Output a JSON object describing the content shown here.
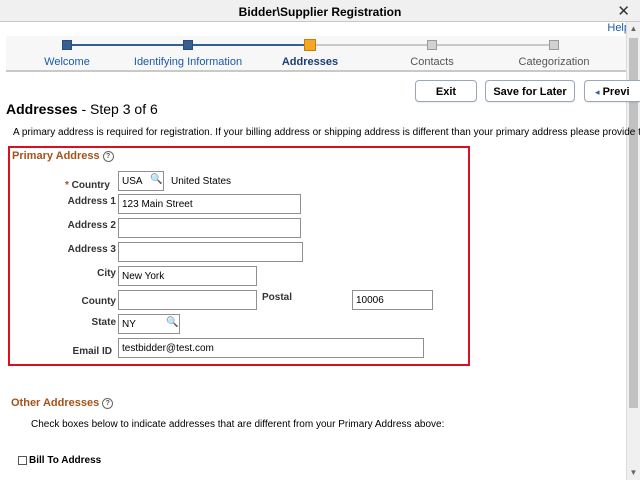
{
  "window": {
    "title": "Bidder\\Supplier Registration",
    "close_glyph": "✕"
  },
  "help_link": "Help",
  "steps": [
    {
      "label": "Welcome",
      "state": "complete"
    },
    {
      "label": "Identifying Information",
      "state": "complete"
    },
    {
      "label": "Addresses",
      "state": "current"
    },
    {
      "label": "Contacts",
      "state": "pending"
    },
    {
      "label": "Categorization",
      "state": "pending"
    }
  ],
  "toolbar": {
    "exit": "Exit",
    "save_for_later": "Save for Later",
    "previous": "Previ",
    "previous_glyph": "◂"
  },
  "page": {
    "title": "Addresses",
    "step_text": "- Step 3 of 6",
    "intro": "A primary address is required for registration.  If your billing address or shipping address is different than your primary address please provide them."
  },
  "primary_address": {
    "title": "Primary Address",
    "help_glyph": "?",
    "fields": {
      "country": {
        "required_mark": "*",
        "label": "Country",
        "value": "USA",
        "description": "United States"
      },
      "address1": {
        "label": "Address 1",
        "value": "123 Main Street"
      },
      "address2": {
        "label": "Address 2",
        "value": ""
      },
      "address3": {
        "label": "Address 3",
        "value": ""
      },
      "city": {
        "label": "City",
        "value": "New York"
      },
      "county": {
        "label": "County",
        "value": ""
      },
      "postal": {
        "label": "Postal",
        "value": "10006"
      },
      "state": {
        "label": "State",
        "value": "NY"
      },
      "email": {
        "label": "Email ID",
        "value": "testbidder@test.com"
      }
    }
  },
  "other_addresses": {
    "title": "Other Addresses",
    "help_glyph": "?",
    "instructions": "Check boxes below to indicate addresses that are different from your Primary Address above:",
    "bill_to_label": "Bill To Address"
  },
  "colors": {
    "accent_blue": "#1a5aa8",
    "node_complete": "#355f92",
    "node_current": "#f5a623",
    "node_pending": "#d2d2d2",
    "section_title": "#a5521a",
    "highlight_border": "#d7111e"
  }
}
